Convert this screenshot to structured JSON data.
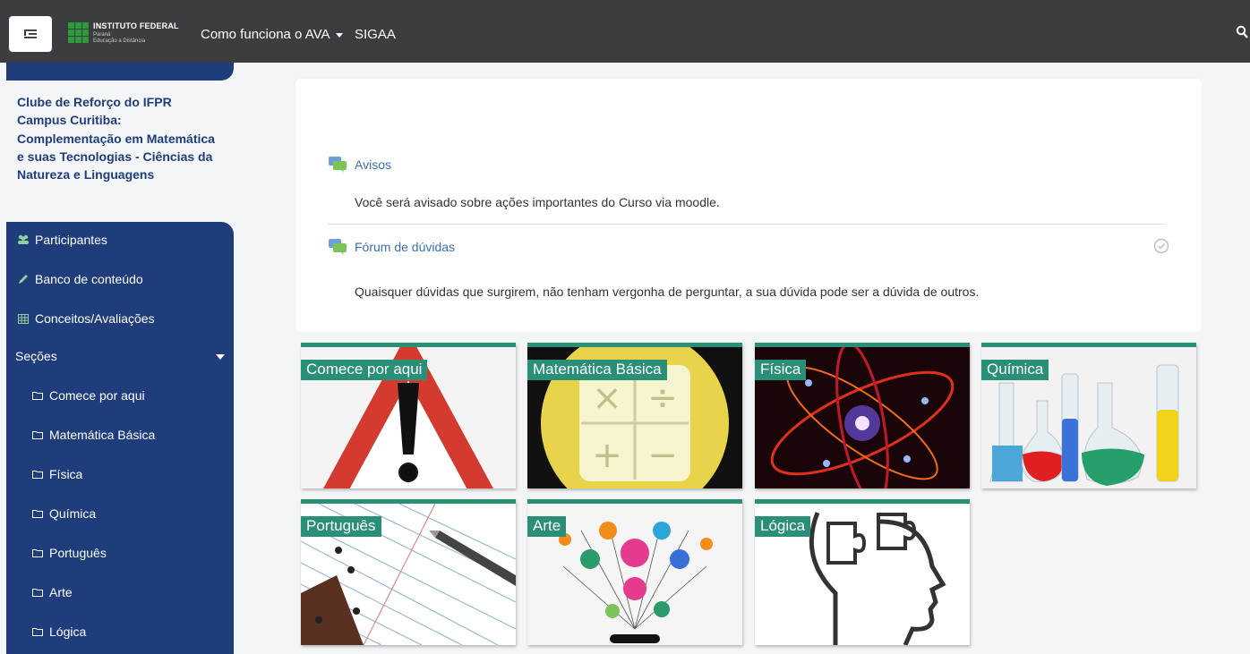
{
  "navbar": {
    "logo": {
      "line1": "INSTITUTO FEDERAL",
      "line2": "Paraná",
      "line3": "Educação a Distância"
    },
    "links": [
      {
        "label": "Como funciona o AVA",
        "has_dropdown": true
      },
      {
        "label": "SIGAA",
        "has_dropdown": false
      }
    ],
    "icons": {
      "menu": "menu-toggle-icon",
      "search": "search-icon"
    },
    "colors": {
      "bar": "#3b3d40"
    }
  },
  "sidebar": {
    "course_title": "Clube de Reforço do IFPR Campus Curitiba: Complementação em Matemática e suas Tecnologias - Ciências da Natureza e Linguagens",
    "items": [
      {
        "label": "Participantes",
        "icon": "users-icon"
      },
      {
        "label": "Banco de conteúdo",
        "icon": "pencil-icon"
      },
      {
        "label": "Conceitos/Avaliações",
        "icon": "table-icon"
      }
    ],
    "sections_label": "Seções",
    "sections": [
      "Comece por aqui",
      "Matemática Básica",
      "Física",
      "Química",
      "Português",
      "Arte",
      "Lógica"
    ],
    "colors": {
      "nav_bg": "#1f3d7a"
    }
  },
  "main": {
    "activities": [
      {
        "name": "Avisos",
        "icon": "forum-icon",
        "description": "Você será avisado sobre ações importantes do Curso via moodle."
      },
      {
        "name": "Fórum de dúvidas",
        "icon": "forum-icon",
        "description": "Quaisquer dúvidas que surgirem, não tenham vergonha de perguntar, a sua dúvida pode ser a dúvida de outros."
      }
    ],
    "tiles": [
      "Comece por aqui",
      "Matemática Básica",
      "Física",
      "Química",
      "Português",
      "Arte",
      "Lógica"
    ],
    "colors": {
      "accent": "#2a8f77",
      "link": "#3a6fb0"
    }
  }
}
